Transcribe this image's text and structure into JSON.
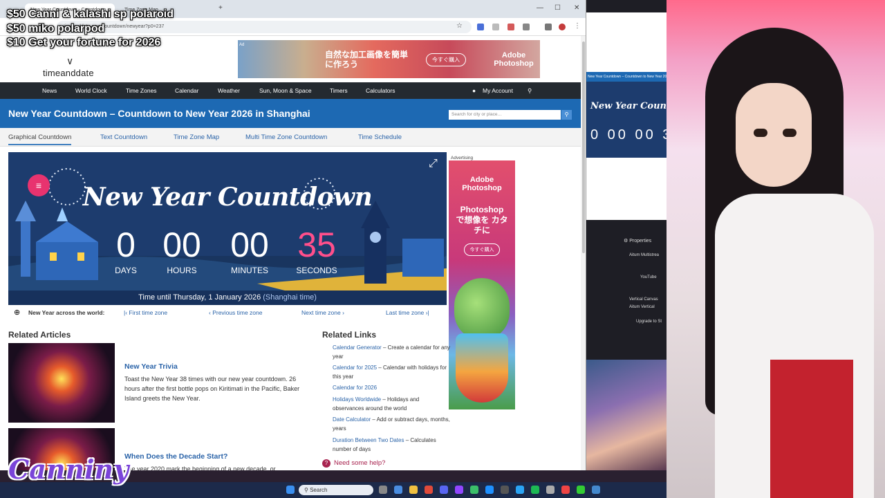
{
  "overlay_lines": [
    "$50 Canni & kalashi sp polaroid",
    "$50 miko polarpod",
    "$10 Get your fortune for 2026"
  ],
  "browser": {
    "tabs": [
      "New Year Countdown - Countdown",
      "Time Zone Map"
    ],
    "url": "timeanddate.com/countdown/newyear?p0=237"
  },
  "site": {
    "logo": "timeanddate",
    "ad_banner": {
      "label": "Ad",
      "text": "自然な加工画像を簡単に作ろう",
      "button": "今すぐ購入",
      "brand": "Adobe Photoshop"
    },
    "nav": [
      "News",
      "World Clock",
      "Time Zones",
      "Calendar",
      "Weather",
      "Sun, Moon & Space",
      "Timers",
      "Calculators"
    ],
    "account": "My Account",
    "title": "New Year Countdown – Countdown to New Year 2026 in Shanghai",
    "search_placeholder": "Search for city or place…",
    "subtabs": [
      "Graphical Countdown",
      "Text Countdown",
      "Time Zone Map",
      "Multi Time Zone Countdown",
      "Time Schedule"
    ]
  },
  "countdown": {
    "title": "New Year Countdown",
    "days": "0",
    "hours": "00",
    "minutes": "00",
    "seconds": "35",
    "labels": [
      "DAYS",
      "HOURS",
      "MINUTES",
      "SECONDS"
    ],
    "footer_prefix": "Time until Thursday, 1 January 2026",
    "footer_loc": "(Shanghai time)"
  },
  "world_row": {
    "label": "New Year across the world:",
    "first": "First time zone",
    "prev": "Previous time zone",
    "next": "Next time zone",
    "last": "Last time zone"
  },
  "side_ad": {
    "label": "Advertising",
    "brand": "Adobe Photoshop",
    "headline": "Photoshop で想像を カタチに",
    "button": "今すぐ購入"
  },
  "related_articles": {
    "heading": "Related Articles",
    "items": [
      {
        "title": "New Year Trivia",
        "text": "Toast the New Year 38 times with our new year countdown. 26 hours after the first bottle pops on Kiritimati in the Pacific, Baker Island greets the New Year."
      },
      {
        "title": "When Does the Decade Start?",
        "text": "The year 2020 mark the beginning of a new decade, or..."
      }
    ]
  },
  "related_links": {
    "heading": "Related Links",
    "items": [
      {
        "link": "Calendar Generator",
        "desc": " – Create a calendar for any year"
      },
      {
        "link": "Calendar for 2025",
        "desc": " – Calendar with holidays for this year"
      },
      {
        "link": "Calendar for 2026",
        "desc": ""
      },
      {
        "link": "Holidays Worldwide",
        "desc": " – Holidays and observances around the world"
      },
      {
        "link": "Date Calculator",
        "desc": " – Add or subtract days, months, years"
      },
      {
        "link": "Duration Between Two Dates",
        "desc": " – Calculates number of days"
      }
    ],
    "help": "Need some help?"
  },
  "obs": {
    "preview_title": "New Year Countdow",
    "preview_nums": "0 00 00 3",
    "rows": [
      "Aitum Multistrea",
      "YouTube",
      "Vertical Canvas",
      "Aitum Vertical",
      "Upgrade to St"
    ],
    "properties": "Properties"
  },
  "taskbar": {
    "search": "Search"
  },
  "brand_overlay": "Canniny"
}
